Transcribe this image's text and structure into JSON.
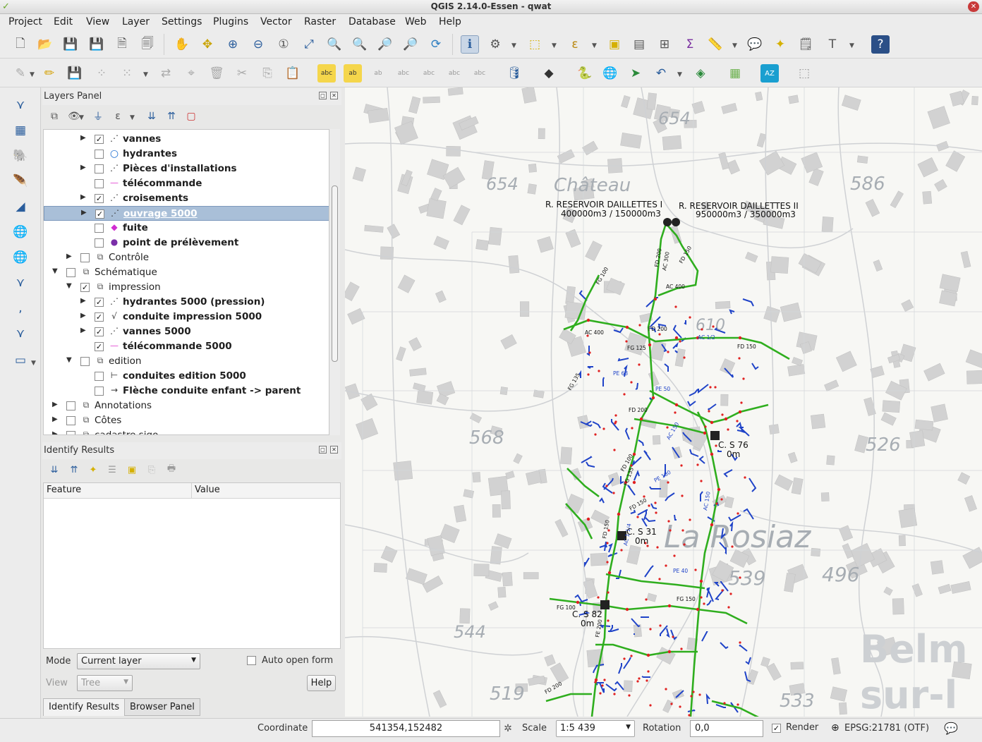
{
  "window": {
    "title": "QGIS 2.14.0-Essen - qwat"
  },
  "menubar": {
    "items": [
      "Project",
      "Edit",
      "View",
      "Layer",
      "Settings",
      "Plugins",
      "Vector",
      "Raster",
      "Database",
      "Web",
      "Help"
    ]
  },
  "layers_panel": {
    "title": "Layers Panel",
    "items": [
      {
        "label": "vannes",
        "bold": true,
        "checked": true,
        "expandable": true,
        "symbol": "dots-icon"
      },
      {
        "label": "hydrantes",
        "bold": true,
        "checked": false,
        "expandable": false,
        "symbol": "circle-icon"
      },
      {
        "label": "Pièces d'installations",
        "bold": true,
        "checked": false,
        "expandable": true,
        "symbol": "dots-icon"
      },
      {
        "label": "télécommande",
        "bold": true,
        "checked": false,
        "expandable": false,
        "symbol": "pink-line-icon"
      },
      {
        "label": "croisements",
        "bold": true,
        "checked": true,
        "expandable": true,
        "symbol": "dots-icon"
      },
      {
        "label": "ouvrage 5000",
        "bold": true,
        "checked": true,
        "expandable": true,
        "symbol": "dots-icon",
        "selected": true
      },
      {
        "label": "fuite",
        "bold": true,
        "checked": false,
        "expandable": false,
        "symbol": "diamond-icon"
      },
      {
        "label": "point de prélèvement",
        "bold": true,
        "checked": false,
        "expandable": false,
        "symbol": "dot-icon"
      },
      {
        "label": "Contrôle",
        "bold": false,
        "checked": false,
        "expandable": true,
        "symbol": "group-icon"
      },
      {
        "label": "Schématique",
        "bold": false,
        "checked": false,
        "expandable": true,
        "expanded": true,
        "symbol": "group-icon"
      },
      {
        "label": "impression",
        "bold": false,
        "checked": true,
        "expandable": true,
        "expanded": true,
        "symbol": "group-icon"
      },
      {
        "label": "hydrantes 5000 (pression)",
        "bold": true,
        "checked": true,
        "expandable": true,
        "symbol": "dots-icon"
      },
      {
        "label": "conduite impression 5000",
        "bold": true,
        "checked": true,
        "expandable": true,
        "symbol": "line-rule-icon"
      },
      {
        "label": "vannes 5000",
        "bold": true,
        "checked": true,
        "expandable": true,
        "symbol": "dots-icon"
      },
      {
        "label": "télécommande 5000",
        "bold": true,
        "checked": true,
        "expandable": false,
        "symbol": "pink-line-icon"
      },
      {
        "label": "edition",
        "bold": false,
        "checked": false,
        "expandable": true,
        "expanded": true,
        "symbol": "group-icon"
      },
      {
        "label": "conduites edition 5000",
        "bold": true,
        "checked": false,
        "expandable": false,
        "symbol": "bar-line-icon"
      },
      {
        "label": "Flèche conduite enfant -> parent",
        "bold": true,
        "checked": false,
        "expandable": false,
        "symbol": "arrow-icon"
      },
      {
        "label": "Annotations",
        "bold": false,
        "checked": false,
        "expandable": true,
        "symbol": "group-icon"
      },
      {
        "label": "Côtes",
        "bold": false,
        "checked": false,
        "expandable": true,
        "symbol": "group-icon"
      },
      {
        "label": "cadastre sigo",
        "bold": false,
        "checked": false,
        "expandable": true,
        "symbol": "group-icon"
      }
    ]
  },
  "identify_panel": {
    "title": "Identify Results",
    "columns": [
      "Feature",
      "Value"
    ],
    "mode_label": "Mode",
    "mode_value": "Current layer",
    "auto_open_label": "Auto open form",
    "view_label": "View",
    "view_value": "Tree",
    "help_label": "Help"
  },
  "bottom_tabs": [
    "Identify Results",
    "Browser Panel"
  ],
  "map": {
    "labels": {
      "res1_name": "R. RESERVOIR DAILLETTES I",
      "res1_vol": "400000m3 / 150000m3",
      "res2_name": "R. RESERVOIR DAILLETTES II",
      "res2_vol": "950000m3 / 350000m3",
      "cs76": "C. S 76",
      "cs76_m": "0m",
      "cs31": "C. S 31",
      "cs31_m": "0m",
      "cs82": "C. S 82",
      "cs82_m": "0m",
      "alt654a": "654",
      "alt654b": "654",
      "chateau": "Château",
      "alt586": "586",
      "alt610": "610",
      "alt568": "568",
      "alt526": "526",
      "rosiaz": "La Rosiaz",
      "alt539": "539",
      "alt496": "496",
      "alt544": "544",
      "alt519": "519",
      "alt533": "533",
      "belm": "Belm",
      "surl": "sur-l",
      "pipes": [
        "FD 200",
        "FG 100",
        "AC 300",
        "FD 150",
        "AC 400",
        "AC 400",
        "FD 200",
        "AC 1/2",
        "FG 125",
        "FD 150",
        "PE 63",
        "PE 50",
        "FG 135",
        "FD 200",
        "AC 150",
        "FD 100",
        "FG 135",
        "AC 1 1/4",
        "FD 150",
        "PE 180",
        "FD 150",
        "PE 40",
        "FG 100",
        "FG 150",
        "FE 200",
        "FD 200",
        "AC 150"
      ]
    },
    "colors": {
      "pipe_green": "#2fae1e",
      "pipe_blue": "#1f43c8",
      "valve_red": "#e02020",
      "topo_text": "#9aa0a8"
    }
  },
  "statusbar": {
    "coordinate_label": "Coordinate",
    "coordinate_value": "541354,152482",
    "scale_label": "Scale",
    "scale_value": "1:5 439",
    "rotation_label": "Rotation",
    "rotation_value": "0,0",
    "render_label": "Render",
    "crs": "EPSG:21781 (OTF)"
  }
}
